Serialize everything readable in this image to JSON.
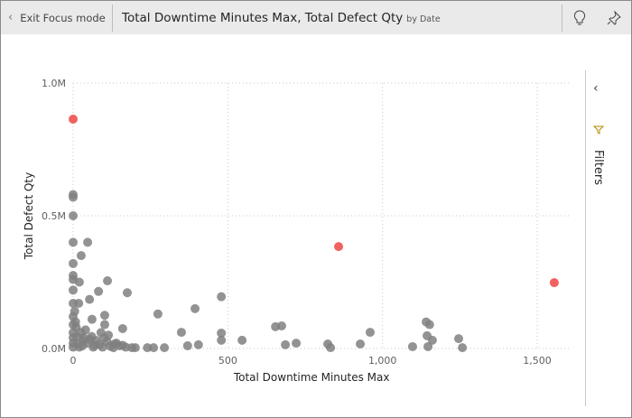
{
  "header": {
    "exit_label": "Exit Focus mode",
    "title": "Total Downtime Minutes Max, Total Defect Qty",
    "title_suffix": "by Date"
  },
  "filters": {
    "label": "Filters"
  },
  "colors": {
    "default": "#808080",
    "highlight": "#f0625f"
  },
  "chart_data": {
    "type": "scatter",
    "xlabel": "Total Downtime Minutes Max",
    "ylabel": "Total Defect Qty",
    "xlim": [
      0,
      1600
    ],
    "ylim": [
      0,
      1000000
    ],
    "xticks": [
      {
        "v": 0,
        "label": "0"
      },
      {
        "v": 500,
        "label": "500"
      },
      {
        "v": 1000,
        "label": "1,000"
      },
      {
        "v": 1500,
        "label": "1,500"
      }
    ],
    "yticks": [
      {
        "v": 0,
        "label": "0.0M"
      },
      {
        "v": 500000,
        "label": "0.5M"
      },
      {
        "v": 1000000,
        "label": "1.0M"
      }
    ],
    "grid": true,
    "highlight_points": [
      [
        0,
        864000
      ],
      [
        858,
        384000
      ],
      [
        1555,
        248000
      ]
    ],
    "points": [
      [
        0,
        580000
      ],
      [
        0,
        570000
      ],
      [
        0,
        500000
      ],
      [
        0,
        400000
      ],
      [
        47,
        400000
      ],
      [
        26,
        350000
      ],
      [
        0,
        320000
      ],
      [
        0,
        275000
      ],
      [
        0,
        260000
      ],
      [
        111,
        255000
      ],
      [
        20,
        250000
      ],
      [
        175,
        210000
      ],
      [
        82,
        215000
      ],
      [
        0,
        220000
      ],
      [
        0,
        170000
      ],
      [
        18,
        170000
      ],
      [
        53,
        185000
      ],
      [
        274,
        130000
      ],
      [
        394,
        150000
      ],
      [
        479,
        195000
      ],
      [
        102,
        125000
      ],
      [
        61,
        110000
      ],
      [
        160,
        75000
      ],
      [
        102,
        90000
      ],
      [
        114,
        50000
      ],
      [
        32,
        30000
      ],
      [
        15,
        17000
      ],
      [
        55,
        34000
      ],
      [
        134,
        17000
      ],
      [
        201,
        3000
      ],
      [
        260,
        3000
      ],
      [
        295,
        3000
      ],
      [
        350,
        61000
      ],
      [
        370,
        10000
      ],
      [
        405,
        14000
      ],
      [
        479,
        58000
      ],
      [
        479,
        31000
      ],
      [
        546,
        31000
      ],
      [
        654,
        82000
      ],
      [
        674,
        85000
      ],
      [
        686,
        14000
      ],
      [
        721,
        20000
      ],
      [
        823,
        17000
      ],
      [
        832,
        3000
      ],
      [
        928,
        17000
      ],
      [
        960,
        61000
      ],
      [
        1097,
        7000
      ],
      [
        1141,
        100000
      ],
      [
        1152,
        90000
      ],
      [
        1144,
        48000
      ],
      [
        1161,
        31000
      ],
      [
        1246,
        37000
      ],
      [
        1258,
        3000
      ],
      [
        1147,
        7000
      ],
      [
        0,
        120000
      ],
      [
        0,
        90000
      ],
      [
        0,
        60000
      ],
      [
        0,
        40000
      ],
      [
        0,
        20000
      ],
      [
        0,
        5000
      ],
      [
        10,
        80000
      ],
      [
        12,
        45000
      ],
      [
        25,
        60000
      ],
      [
        30,
        10000
      ],
      [
        40,
        70000
      ],
      [
        45,
        20000
      ],
      [
        60,
        45000
      ],
      [
        65,
        5000
      ],
      [
        75,
        30000
      ],
      [
        85,
        15000
      ],
      [
        90,
        60000
      ],
      [
        95,
        5000
      ],
      [
        110,
        25000
      ],
      [
        120,
        8000
      ],
      [
        140,
        20000
      ],
      [
        150,
        10000
      ],
      [
        170,
        5000
      ],
      [
        5,
        140000
      ],
      [
        8,
        100000
      ],
      [
        20,
        5000
      ],
      [
        35,
        40000
      ],
      [
        70,
        12000
      ],
      [
        100,
        40000
      ],
      [
        130,
        3000
      ],
      [
        160,
        12000
      ],
      [
        190,
        3000
      ],
      [
        240,
        3000
      ]
    ]
  }
}
